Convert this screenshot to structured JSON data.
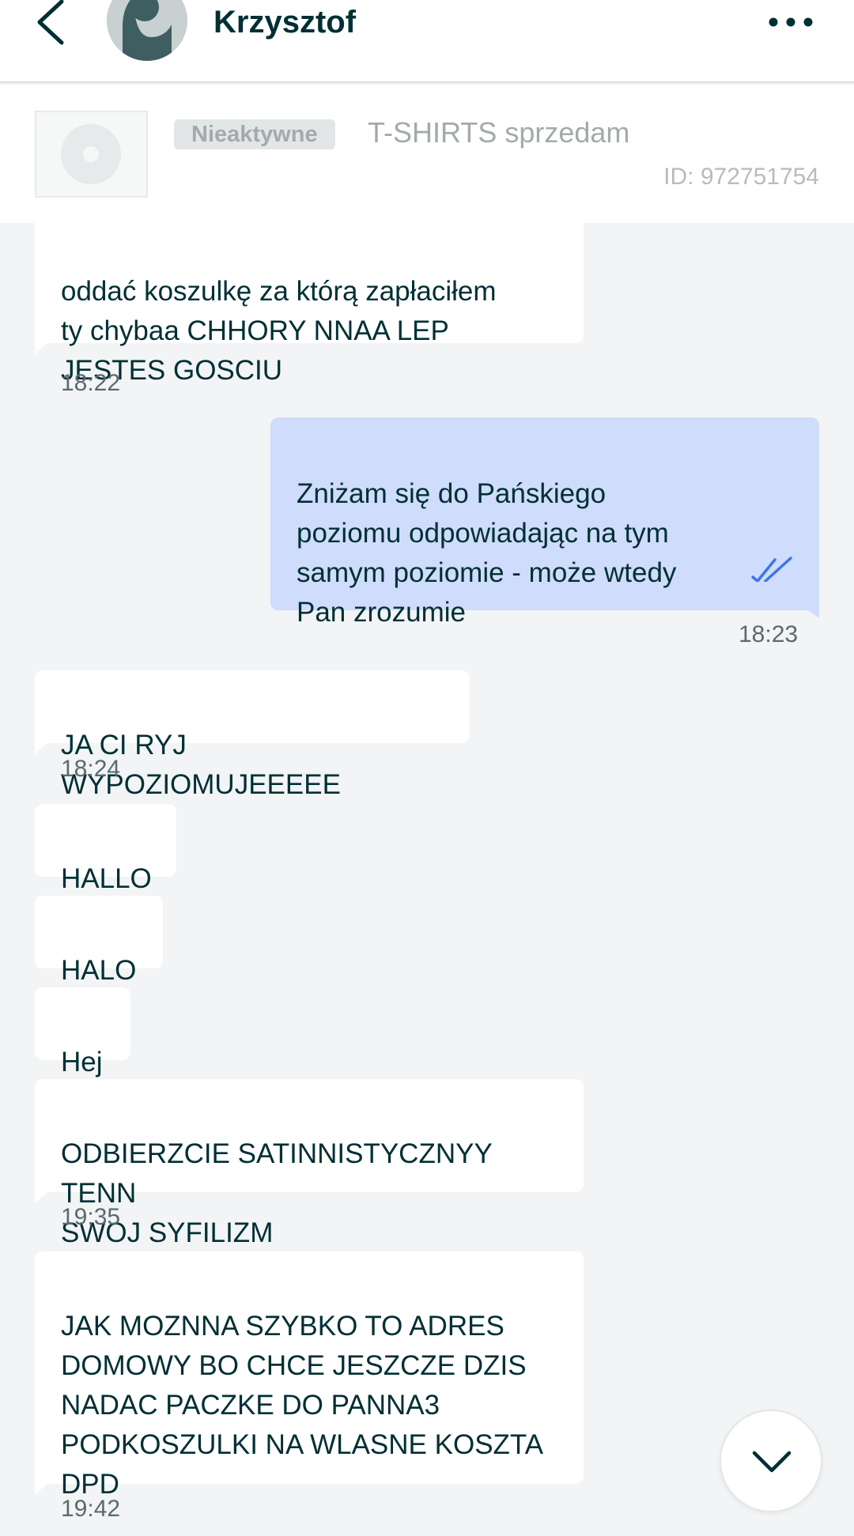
{
  "header": {
    "contact_name": "Krzysztof",
    "back_icon": "chevron-left-icon",
    "more_icon": "more-horizontal-icon"
  },
  "ad": {
    "status": "Nieaktywne",
    "title": "T-SHIRTS sprzedam",
    "id_text": "ID: 972751754"
  },
  "messages": [
    {
      "direction": "incoming",
      "text": "oddać koszulkę za którą zapłaciłem\n  ty chybaa CHHORY NNAA LEP\nJESTES GOSCIU",
      "time": "18:22"
    },
    {
      "direction": "outgoing",
      "text": "Zniżam się do Pańskiego\npoziomu odpowiadając na tym\nsamym poziomie - może wtedy\nPan zrozumie",
      "time": "18:23",
      "status": "read"
    },
    {
      "direction": "incoming",
      "text": "JA CI RYJ WYPOZIOMUJEEEEE",
      "time": "18:24"
    },
    {
      "direction": "incoming",
      "text": "HALLO",
      "time": ""
    },
    {
      "direction": "incoming",
      "text": "HALO",
      "time": ""
    },
    {
      "direction": "incoming",
      "text": "Hej",
      "time": ""
    },
    {
      "direction": "incoming",
      "text": "ODBIERZCIE  SATINNISTYCZNYY TENN\nSWOJ SYFILIZM",
      "time": "19:35"
    },
    {
      "direction": "incoming",
      "text": "JAK  MOZNNA  SZYBKO  TO  ADRES\nDOMOWY  BO  CHCE  JESZCZE DZIS\nNADAC  PACZKE  DO  PANNA3\nPODKOSZULKI  NA WLASNE KOSZTA\nDPD",
      "time": "19:42"
    }
  ],
  "scroll_down_icon": "chevron-down-icon",
  "colors": {
    "background": "#f2f4f5",
    "incoming_bubble": "#ffffff",
    "outgoing_bubble": "#cfdcfb",
    "text": "#002f34",
    "read_check": "#3a77e8"
  }
}
